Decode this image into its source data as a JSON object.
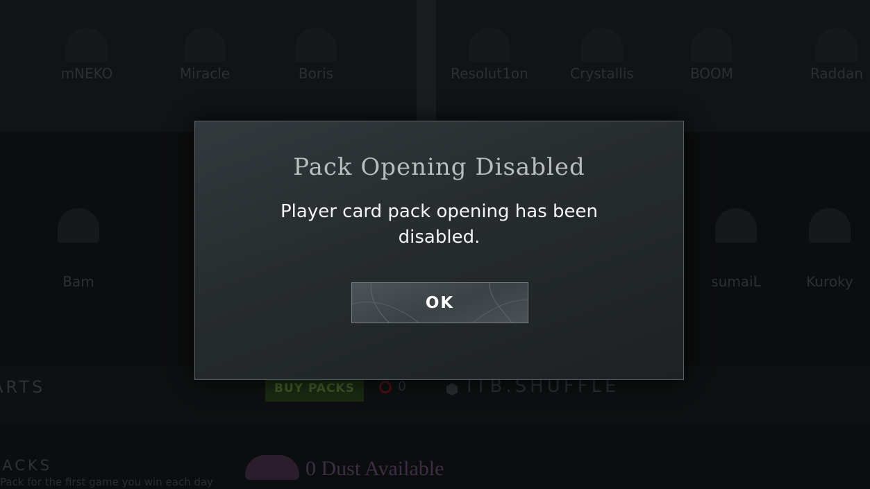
{
  "background": {
    "player_names_top": [
      "mNEKO",
      "Miracle",
      "Boris",
      "Resolut1on",
      "Crystallis",
      "BOOM",
      "Raddan"
    ],
    "player_names_middle": [
      "Bam",
      "",
      "sumaiL",
      "Kuroky"
    ],
    "section_title": "ARTS",
    "buy_packs_label": "BUY PACKS",
    "pack_count": "0",
    "username": "ITB.SHUFFLE",
    "packs_section_title": "PACKS",
    "packs_subtitle": "Pack for the first game you win each day",
    "dust_label": "0 Dust Available"
  },
  "modal": {
    "title": "Pack Opening Disabled",
    "message": "Player card pack opening has been disabled.",
    "ok_label": "OK"
  },
  "colors": {
    "modal_border": "#5c6266",
    "modal_bg_top": "#33393c",
    "modal_bg_bottom": "#1d2123",
    "title_text": "#b8bdc0",
    "message_text": "#f2f4f5",
    "button_bg": "#434b4f"
  }
}
